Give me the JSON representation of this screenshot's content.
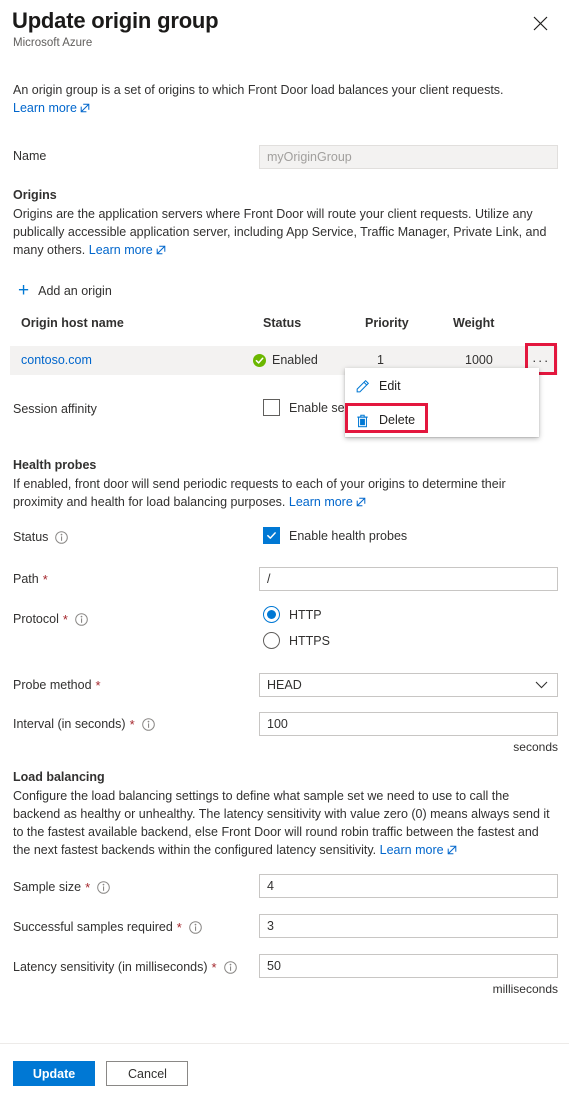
{
  "header": {
    "title": "Update origin group",
    "subtitle": "Microsoft Azure",
    "close_label": "✕"
  },
  "intro": {
    "text": "An origin group is a set of origins to which Front Door load balances your client requests.",
    "learn_more": "Learn more"
  },
  "name_row": {
    "label": "Name",
    "value": "myOriginGroup"
  },
  "origins": {
    "title": "Origins",
    "description_part1": "Origins are the application servers where Front Door will route your client requests. Utilize any publically accessible application server, including App Service, Traffic Manager, Private Link, and many others.",
    "learn_more": "Learn more",
    "add_label": "Add an origin",
    "columns": [
      "Origin host name",
      "Status",
      "Priority",
      "Weight"
    ],
    "rows": [
      {
        "host": "contoso.com",
        "status": "Enabled",
        "priority": "1",
        "weight": "1000",
        "menu_label": "···"
      }
    ]
  },
  "context_menu": {
    "items": [
      {
        "label": "Edit",
        "icon": "pencil-icon"
      },
      {
        "label": "Delete",
        "icon": "trash-icon"
      }
    ]
  },
  "session_affinity": {
    "label": "Session affinity",
    "checkbox_label": "Enable session affinity",
    "checked": false
  },
  "health_probes": {
    "title": "Health probes",
    "description": "If enabled, front door will send periodic requests to each of your origins to determine their proximity and health for load balancing purposes.",
    "learn_more": "Learn more",
    "status_label": "Status",
    "status_checkbox_label": "Enable health probes",
    "status_checked": true,
    "path_label": "Path",
    "path_value": "/",
    "protocol_label": "Protocol",
    "protocol_options": [
      "HTTP",
      "HTTPS"
    ],
    "protocol_selected": "HTTP",
    "probe_method_label": "Probe method",
    "probe_method_value": "HEAD",
    "interval_label": "Interval (in seconds)",
    "interval_value": "100",
    "interval_suffix": "seconds"
  },
  "load_balancing": {
    "title": "Load balancing",
    "description": "Configure the load balancing settings to define what sample set we need to use to call the backend as healthy or unhealthy. The latency sensitivity with value zero (0) means always send it to the fastest available backend, else Front Door will round robin traffic between the fastest and the next fastest backends within the configured latency sensitivity.",
    "learn_more": "Learn more",
    "sample_size_label": "Sample size",
    "sample_size_value": "4",
    "successful_samples_label": "Successful samples required",
    "successful_samples_value": "3",
    "latency_label": "Latency sensitivity (in milliseconds)",
    "latency_value": "50",
    "latency_suffix": "milliseconds"
  },
  "footer": {
    "update_label": "Update",
    "cancel_label": "Cancel"
  },
  "colors": {
    "accent": "#0078d4",
    "link": "#0066cc",
    "success": "#6bb700",
    "required": "#a4262c",
    "highlight": "#e3173e",
    "row_bg": "#f3f2f1"
  }
}
